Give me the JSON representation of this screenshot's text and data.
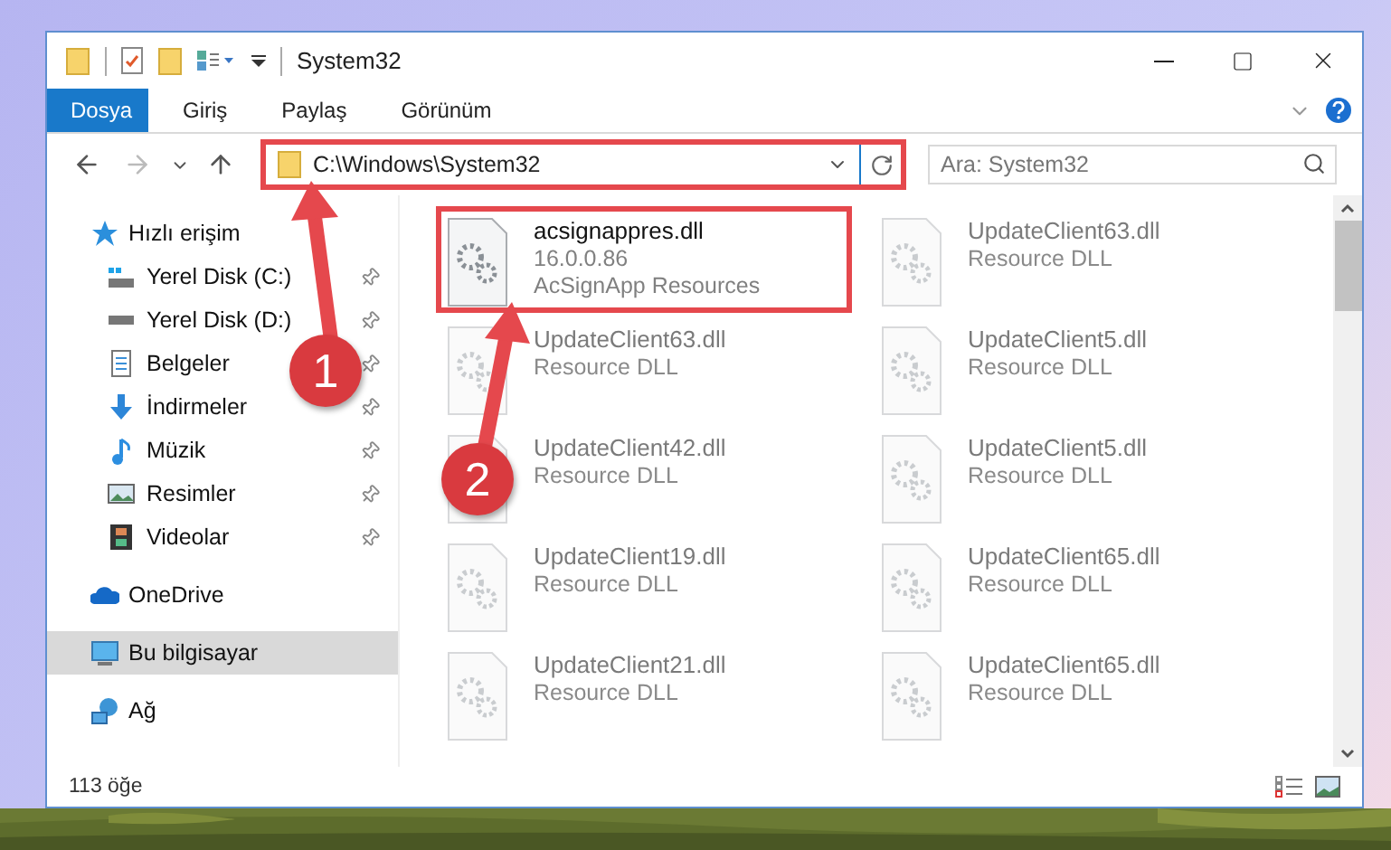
{
  "window": {
    "title": "System32"
  },
  "ribbon": {
    "tabs": [
      {
        "label": "Dosya",
        "kind": "file"
      },
      {
        "label": "Giriş",
        "kind": "tab"
      },
      {
        "label": "Paylaş",
        "kind": "tab"
      },
      {
        "label": "Görünüm",
        "kind": "tab"
      }
    ]
  },
  "address_bar": {
    "path": "C:\\Windows\\System32",
    "highlighted": true
  },
  "search": {
    "placeholder": "Ara: System32"
  },
  "sidebar": {
    "items": [
      {
        "label": "Hızlı erişim",
        "selected": false,
        "children": [
          {
            "label": "Yerel Disk (C:)",
            "pinned": true,
            "selected": false
          },
          {
            "label": "Yerel Disk (D:)",
            "pinned": true,
            "selected": false
          },
          {
            "label": "Belgeler",
            "pinned": true,
            "selected": false
          },
          {
            "label": "İndirmeler",
            "pinned": true,
            "selected": false
          },
          {
            "label": "Müzik",
            "pinned": true,
            "selected": false
          },
          {
            "label": "Resimler",
            "pinned": true,
            "selected": false
          },
          {
            "label": "Videolar",
            "pinned": true,
            "selected": false
          }
        ]
      },
      {
        "label": "OneDrive",
        "selected": false
      },
      {
        "label": "Bu bilgisayar",
        "selected": true
      },
      {
        "label": "Ağ",
        "selected": false
      }
    ]
  },
  "files": [
    {
      "name": "acsignappres.dll",
      "details": [
        "16.0.0.86",
        "AcSignApp Resources"
      ],
      "blurred": false,
      "highlighted": true
    },
    {
      "name": "UpdateClient63.dll",
      "details": [
        "Resource DLL"
      ],
      "blurred": true,
      "highlighted": false
    },
    {
      "name": "UpdateClient63.dll",
      "details": [
        "Resource DLL"
      ],
      "blurred": true,
      "highlighted": false
    },
    {
      "name": "UpdateClient5.dll",
      "details": [
        "Resource DLL"
      ],
      "blurred": true,
      "highlighted": false
    },
    {
      "name": "UpdateClient42.dll",
      "details": [
        "Resource DLL"
      ],
      "blurred": true,
      "highlighted": false
    },
    {
      "name": "UpdateClient5.dll",
      "details": [
        "Resource DLL"
      ],
      "blurred": true,
      "highlighted": false
    },
    {
      "name": "UpdateClient19.dll",
      "details": [
        "Resource DLL"
      ],
      "blurred": true,
      "highlighted": false
    },
    {
      "name": "UpdateClient65.dll",
      "details": [
        "Resource DLL"
      ],
      "blurred": true,
      "highlighted": false
    },
    {
      "name": "UpdateClient21.dll",
      "details": [
        "Resource DLL"
      ],
      "blurred": true,
      "highlighted": false
    },
    {
      "name": "UpdateClient65.dll",
      "details": [
        "Resource DLL"
      ],
      "blurred": true,
      "highlighted": false
    }
  ],
  "status_bar": {
    "count": "113 öğe"
  },
  "annotations": [
    {
      "label": "1"
    },
    {
      "label": "2"
    }
  ]
}
